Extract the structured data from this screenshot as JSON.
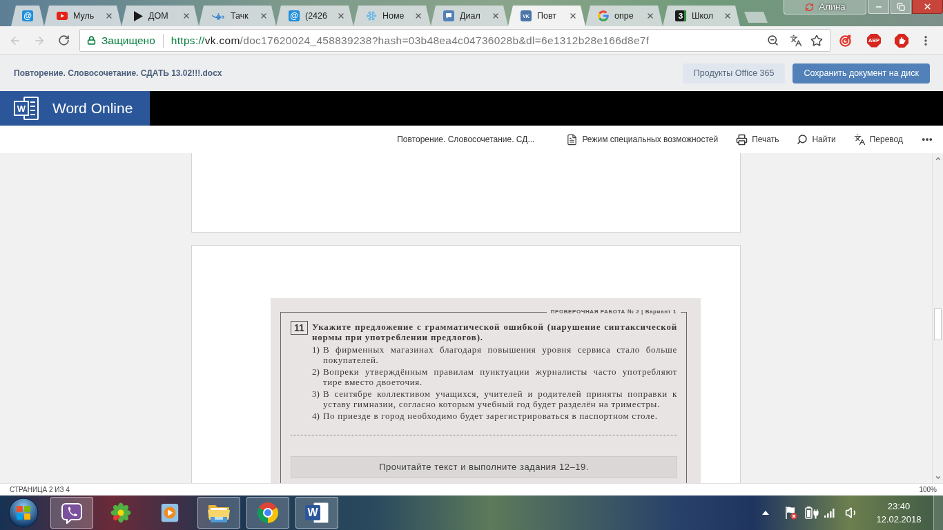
{
  "browser": {
    "tabs": [
      {
        "kind": "mail",
        "glyph": "@",
        "selected": false
      },
      {
        "kind": "youtube",
        "title": "Муль",
        "selected": false
      },
      {
        "kind": "play",
        "title": "ДОМ",
        "selected": false
      },
      {
        "kind": "lamp",
        "title": "Тачк",
        "selected": false
      },
      {
        "kind": "mail",
        "glyph": "@",
        "title": "(2426",
        "selected": false
      },
      {
        "kind": "snowflake",
        "title": "Номе",
        "selected": false
      },
      {
        "kind": "chat",
        "title": "Диал",
        "selected": false
      },
      {
        "kind": "vk",
        "glyph": "VK",
        "title": "Повт",
        "selected": true
      },
      {
        "kind": "google",
        "title": "опре",
        "selected": false
      },
      {
        "kind": "letter",
        "glyph": "З",
        "title": "Школ",
        "selected": false
      }
    ],
    "profile": "Алина",
    "address": {
      "security": "Защищено",
      "scheme": "https://",
      "host": "vk.com",
      "path": "/doc17620024_458839238?hash=03b48ea4c04736028b&dl=6e1312b28e166d8e7f"
    },
    "adblock_badge": "ABP"
  },
  "document_header": {
    "title": "Повторение. Словосочетание. СДАТЬ 13.02!!!.docx",
    "buttons": [
      {
        "kind": "secondary",
        "label": "Продукты Office 365"
      },
      {
        "kind": "primary",
        "label": "Сохранить документ на диск"
      }
    ]
  },
  "word_bar": {
    "logo_glyph": "W",
    "app_name": "Word Online"
  },
  "toolbar": {
    "document_title": "Повторение. Словосочетание. СД...",
    "items": [
      {
        "kind": "accessibility",
        "label": "Режим специальных возможностей"
      },
      {
        "kind": "print",
        "label": "Печать"
      },
      {
        "kind": "find",
        "label": "Найти"
      },
      {
        "kind": "translate",
        "label": "Перевод"
      }
    ]
  },
  "document": {
    "scan": {
      "header": "ПРОВЕРОЧНАЯ РАБОТА № 2 | Вариант 1",
      "task_number": "11",
      "question": "Укажите предложение с грамматической ошибкой (нарушение синтаксической нормы при употреблении предлогов).",
      "options": [
        {
          "number": "1)",
          "text": "В фирменных магазинах благодаря повышения уровня сервиса стало больше покупателей."
        },
        {
          "number": "2)",
          "text": "Вопреки утверждённым правилам пунктуации журналисты часто употребляют тире вместо двоеточия."
        },
        {
          "number": "3)",
          "text": "В сентябре коллективом учащихся, учителей и родителей приняты поправки к уставу гимназии, согласно которым учебный год будет разделён на триместры."
        },
        {
          "number": "4)",
          "text": "По приезде в город необходимо будет зарегистрироваться в паспортном столе."
        }
      ],
      "footer": "Прочитайте текст и выполните задания 12–19."
    }
  },
  "status_bar": {
    "page": "СТРАНИЦА 2 ИЗ 4",
    "zoom": "100%"
  },
  "taskbar": {
    "apps": [
      {
        "kind": "viber",
        "running": true
      },
      {
        "kind": "icq",
        "running": false
      },
      {
        "kind": "media",
        "running": false
      },
      {
        "kind": "explorer",
        "running": true
      },
      {
        "kind": "chrome",
        "running": true
      },
      {
        "kind": "word",
        "glyph": "W",
        "running": true
      }
    ],
    "time": "23:40",
    "date": "12.02.2018"
  }
}
